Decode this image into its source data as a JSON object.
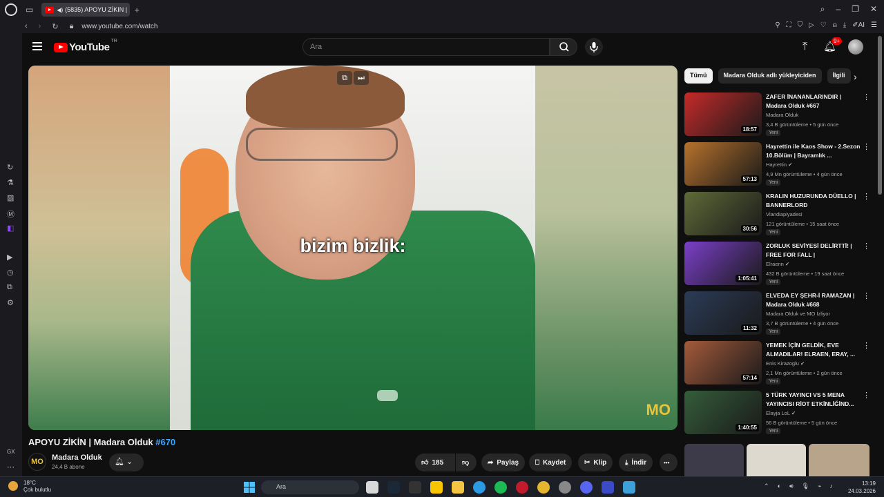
{
  "browser": {
    "tab_title": "(5835) APOYU ZİKIN |",
    "url": "www.youtube.com/watch",
    "new_tab": "+",
    "ai_label": "AI"
  },
  "youtube": {
    "logo_text": "YouTube",
    "logo_region": "TR",
    "search_placeholder": "Ara",
    "notifications_badge": "9+"
  },
  "video": {
    "caption": "bizim bizlik:",
    "title_main": "APOYU ZİKİN | Madara Olduk ",
    "title_hashtag": "#670",
    "watermark": "MO"
  },
  "channel": {
    "name": "Madara Olduk",
    "subscribers": "24,4 B abone",
    "avatar_text": "MO"
  },
  "actions": {
    "likes": "185",
    "share": "Paylaş",
    "save": "Kaydet",
    "clip": "Klip",
    "download": "İndir",
    "more": "•••"
  },
  "chips": [
    "Tümü",
    "Madara Olduk adlı yükleyiciden",
    "İlgili"
  ],
  "recommendations": [
    {
      "title": "ZAFER İNANANLARINDIR | Madara Olduk #667",
      "channel": "Madara Olduk",
      "meta": "3,4 B görüntüleme • 5 gün önce",
      "badge": "Yeni",
      "duration": "18:57",
      "thumb_color": "#c62a2a"
    },
    {
      "title": "Hayrettin ile Kaos Show - 2.Sezon 10.Bölüm | Bayramlık ...",
      "channel": "Hayrettin ✔",
      "meta": "4,9 Mn görüntüleme • 4 gün önce",
      "badge": "Yeni",
      "duration": "57:13",
      "thumb_color": "#b7722c"
    },
    {
      "title": "KRALIN HUZURUNDA DÜELLO | BANNERLORD",
      "channel": "Vlandiapiyadesi",
      "meta": "121 görüntüleme • 15 saat önce",
      "badge": "Yeni",
      "duration": "30:56",
      "thumb_color": "#5f6a38"
    },
    {
      "title": "ZORLUK SEVİYESİ DELİRTTİ! | FREE FOR FALL |",
      "channel": "Elraenn ✔",
      "meta": "432 B görüntüleme • 19 saat önce",
      "badge": "Yeni",
      "duration": "1:05:41",
      "thumb_color": "#7b3fc9"
    },
    {
      "title": "ELVEDA EY ŞEHR-İ RAMAZAN | Madara Olduk #668",
      "channel": "Madara Olduk ve MO İzliyor",
      "meta": "3,7 B görüntüleme • 4 gün önce",
      "badge": "Yeni",
      "duration": "11:32",
      "thumb_color": "#2b3b57"
    },
    {
      "title": "YEMEK İÇİN GELDİK, EVE ALMADILAR! ELRAEN, ERAY, ...",
      "channel": "Enis Kirazoglu ✔",
      "meta": "2,1 Mn görüntüleme • 2 gün önce",
      "badge": "Yeni",
      "duration": "57:14",
      "thumb_color": "#a45a3a"
    },
    {
      "title": "5 TÜRK YAYINCI VS 5 MENA YAYINCISI RİOT ETKİNLİĞİND...",
      "channel": "Elayja LoL ✔",
      "meta": "56 B görüntüleme • 5 gün önce",
      "badge": "Yeni",
      "duration": "1:40:55",
      "thumb_color": "#355d3a"
    }
  ],
  "taskbar": {
    "temperature": "18°C",
    "condition": "Çok bulutlu",
    "search": "Ara",
    "time": "13:19",
    "date": "24.03.2026"
  },
  "opera_sidebar_label": "GX"
}
